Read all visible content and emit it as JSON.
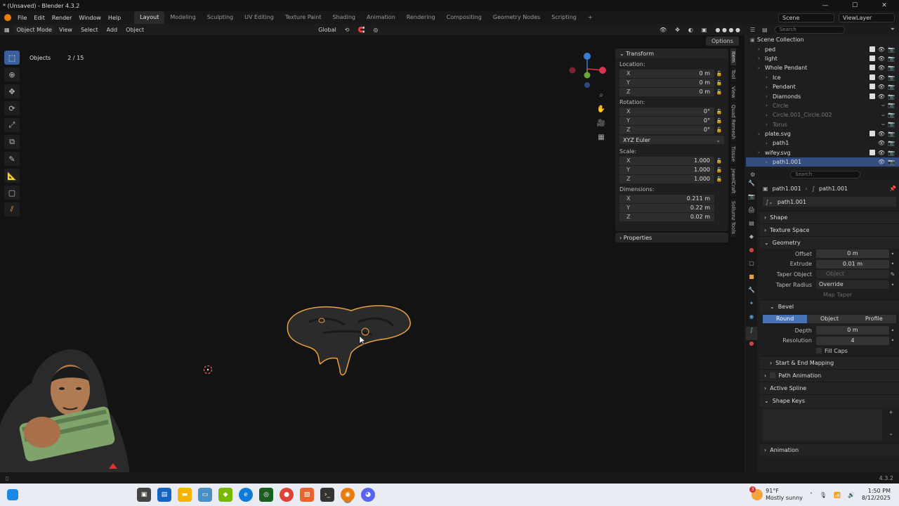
{
  "window": {
    "title": "* (Unsaved) - Blender 4.3.2",
    "controls": [
      "—",
      "☐",
      "✕"
    ]
  },
  "menu": {
    "items": [
      "File",
      "Edit",
      "Render",
      "Window",
      "Help"
    ],
    "workspaces": [
      "Layout",
      "Modeling",
      "Sculpting",
      "UV Editing",
      "Texture Paint",
      "Shading",
      "Animation",
      "Rendering",
      "Compositing",
      "Geometry Nodes",
      "Scripting"
    ],
    "add_tab": "+",
    "scene": "Scene",
    "view_layer": "ViewLayer"
  },
  "viewport_header": {
    "mode": "Object Mode",
    "menus": [
      "View",
      "Select",
      "Add",
      "Object"
    ],
    "orientation": "Global",
    "options": "Options"
  },
  "viewport": {
    "objects_label": "Objects",
    "objects_count": "2 / 15"
  },
  "npanel": {
    "transform_header": "Transform",
    "location_label": "Location:",
    "location": [
      {
        "axis": "X",
        "value": "0 m"
      },
      {
        "axis": "Y",
        "value": "0 m"
      },
      {
        "axis": "Z",
        "value": "0 m"
      }
    ],
    "rotation_label": "Rotation:",
    "rotation": [
      {
        "axis": "X",
        "value": "0°"
      },
      {
        "axis": "Y",
        "value": "0°"
      },
      {
        "axis": "Z",
        "value": "0°"
      }
    ],
    "rotation_mode": "XYZ Euler",
    "scale_label": "Scale:",
    "scale": [
      {
        "axis": "X",
        "value": "1.000"
      },
      {
        "axis": "Y",
        "value": "1.000"
      },
      {
        "axis": "Z",
        "value": "1.000"
      }
    ],
    "dimensions_label": "Dimensions:",
    "dimensions": [
      {
        "axis": "X",
        "value": "0.211 m"
      },
      {
        "axis": "Y",
        "value": "0.22 m"
      },
      {
        "axis": "Z",
        "value": "0.02 m"
      }
    ],
    "properties_header": "Properties"
  },
  "side_tabs": [
    "Item",
    "Tool",
    "View",
    "Quad Remesh",
    "Tissue",
    "JewelCraft",
    "Sollumz Tools"
  ],
  "outliner": {
    "search_placeholder": "Search",
    "rows": [
      {
        "name": "Scene Collection",
        "indent": 0,
        "dim": false,
        "selected": false
      },
      {
        "name": "ped",
        "indent": 1,
        "dim": false,
        "selected": false
      },
      {
        "name": "light",
        "indent": 1,
        "dim": false,
        "selected": false
      },
      {
        "name": "Whole Pendant",
        "indent": 1,
        "dim": false,
        "selected": false
      },
      {
        "name": "Ice",
        "indent": 2,
        "dim": false,
        "selected": false
      },
      {
        "name": "Pendant",
        "indent": 2,
        "dim": false,
        "selected": false
      },
      {
        "name": "Diamonds",
        "indent": 2,
        "dim": false,
        "selected": false
      },
      {
        "name": "Circle",
        "indent": 2,
        "dim": true,
        "selected": false
      },
      {
        "name": "Circle.001_Circle.002",
        "indent": 2,
        "dim": true,
        "selected": false
      },
      {
        "name": "Torus",
        "indent": 2,
        "dim": true,
        "selected": false
      },
      {
        "name": "plate.svg",
        "indent": 1,
        "dim": false,
        "selected": false
      },
      {
        "name": "path1",
        "indent": 2,
        "dim": false,
        "selected": false
      },
      {
        "name": "wifey.svg",
        "indent": 1,
        "dim": false,
        "selected": false
      },
      {
        "name": "path1.001",
        "indent": 2,
        "dim": false,
        "selected": true
      }
    ]
  },
  "properties": {
    "search_placeholder": "Search",
    "breadcrumb_object": "path1.001",
    "breadcrumb_data": "path1.001",
    "data_name": "path1.001",
    "sections": {
      "shape": "Shape",
      "texture_space": "Texture Space",
      "geometry": "Geometry",
      "bevel": "Bevel",
      "start_end": "Start & End Mapping",
      "path_animation": "Path Animation",
      "active_spline": "Active Spline",
      "shape_keys": "Shape Keys",
      "animation": "Animation"
    },
    "geometry": {
      "offset_label": "Offset",
      "offset": "0 m",
      "extrude_label": "Extrude",
      "extrude": "0.01 m",
      "taper_object_label": "Taper Object",
      "taper_object_placeholder": "Object",
      "taper_radius_label": "Taper Radius",
      "taper_radius": "Override",
      "map_taper": "Map Taper"
    },
    "bevel": {
      "modes": [
        "Round",
        "Object",
        "Profile"
      ],
      "active_mode": "Round",
      "depth_label": "Depth",
      "depth": "0 m",
      "resolution_label": "Resolution",
      "resolution": "4",
      "fill_caps": "Fill Caps"
    }
  },
  "statusbar": {
    "version": "4.3.2"
  },
  "taskbar": {
    "weather_badge": "3",
    "temperature": "91°F",
    "condition": "Mostly sunny",
    "time": "1:50 PM",
    "date": "8/12/2025"
  },
  "colors": {
    "selection": "#334d80",
    "accent": "#4772b3",
    "outline": "#e8a23c"
  }
}
